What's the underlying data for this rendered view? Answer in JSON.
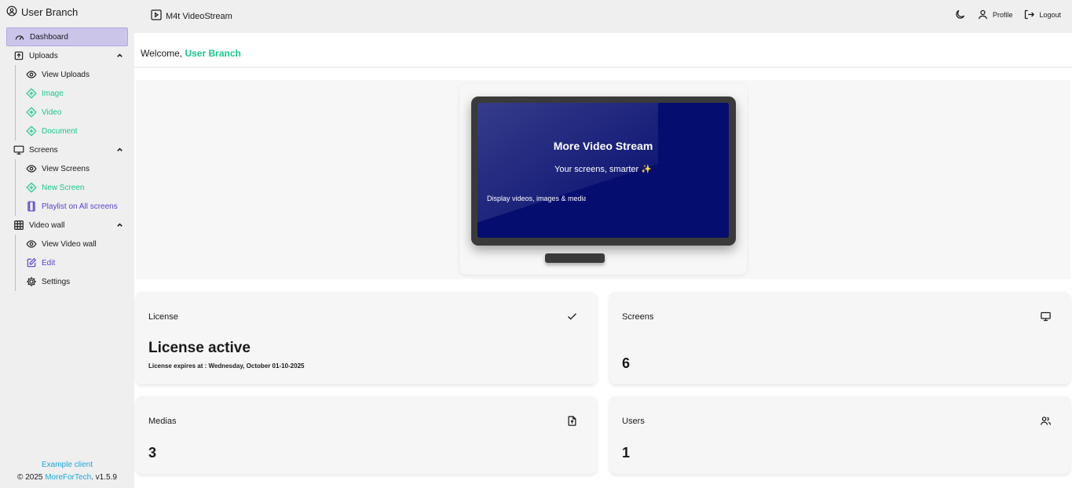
{
  "sidebar": {
    "user_name": "User Branch",
    "items": [
      {
        "label": "Dashboard"
      },
      {
        "label": "Uploads"
      },
      {
        "label": "View Uploads"
      },
      {
        "label": "Image"
      },
      {
        "label": "Video"
      },
      {
        "label": "Document"
      },
      {
        "label": "Screens"
      },
      {
        "label": "View Screens"
      },
      {
        "label": "New Screen"
      },
      {
        "label": "Playlist on All screens"
      },
      {
        "label": "Video wall"
      },
      {
        "label": "View Video wall"
      },
      {
        "label": "Edit"
      },
      {
        "label": "Settings"
      }
    ],
    "footer": {
      "client": "Example client",
      "copyright_prefix": "© 2025 ",
      "company": "MoreForTech",
      "version": ". v1.5.9"
    }
  },
  "topbar": {
    "app_name": "M4t VideoStream",
    "profile_label": "Profile",
    "logout_label": "Logout"
  },
  "welcome": {
    "prefix": "Welcome, ",
    "user": "User Branch"
  },
  "hero": {
    "title": "More Video Stream",
    "subtitle": "Your screens, smarter ✨",
    "caption": "Display videos, images & media"
  },
  "cards": {
    "license": {
      "label": "License",
      "status": "License active",
      "expiry": "License expires at : Wednesday, October 01-10-2025"
    },
    "screens": {
      "label": "Screens",
      "value": "6"
    },
    "medias": {
      "label": "Medias",
      "value": "3"
    },
    "users": {
      "label": "Users",
      "value": "1"
    }
  },
  "colors": {
    "accent_green": "#17c98a",
    "accent_purple": "#5b3fd1",
    "active_nav": "#cbc5ea",
    "link_blue": "#1ea7d8",
    "screen_blue": "#050d6e"
  }
}
